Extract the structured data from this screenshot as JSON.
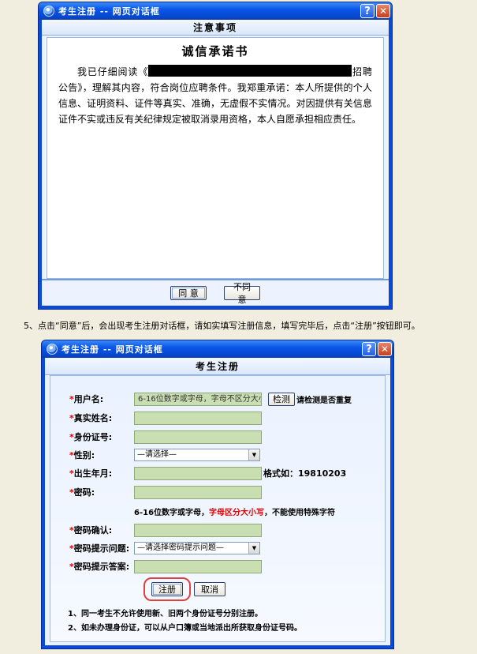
{
  "dialog1": {
    "title": "考生注册 -- 网页对话框",
    "help": "?",
    "close": "✕",
    "header": "注意事项",
    "pledge_title": "诚信承诺书",
    "text_before": "我已仔细阅读《",
    "text_after": "招聘公告》，理解其内容，符合岗位应聘条件。我郑重承诺：本人所提供的个人信息、证明资料、证件等真实、准确，无虚假不实情况。对因提供有关信息证件不实或违反有关纪律规定被取消录用资格，本人自愿承担相应责任。",
    "agree_label": "同 意",
    "disagree_label": "不同意"
  },
  "instruction": "5、点击“同意”后，会出现考生注册对话框，请如实填写注册信息，填写完毕后，点击“注册”按钮即可。",
  "dialog2": {
    "title": "考生注册 -- 网页对话框",
    "help": "?",
    "close": "✕",
    "header": "考生注册",
    "star": "*",
    "fields": {
      "username": {
        "label": "用户名:",
        "placeholder": "6-16位数字或字母，字母不区分大小写"
      },
      "realname": {
        "label": "真实姓名:"
      },
      "idnumber": {
        "label": "身份证号:"
      },
      "gender": {
        "label": "性别:",
        "selected": "—请选择—"
      },
      "birth": {
        "label": "出生年月:",
        "hint": "格式如：19810203"
      },
      "password": {
        "label": "密码:"
      },
      "password_confirm": {
        "label": "密码确认:"
      },
      "question": {
        "label": "密码提示问题:",
        "selected": "—请选择密码提示问题—"
      },
      "answer": {
        "label": "密码提示答案:"
      }
    },
    "check_button": "检测",
    "check_hint": "请检测是否重复",
    "pwd_note_a": "6-16位数字或字母，",
    "pwd_note_red": "字母区分大小写",
    "pwd_note_b": "，不能使用特殊字符",
    "register_button": "注册",
    "cancel_button": "取消",
    "note1": "1、同一考生不允许使用新、旧两个身份证号分别注册。",
    "note2": "2、如未办理身份证，可以从户口簿或当地派出所获取身份证号码。"
  },
  "colors": {
    "titlebar": "#0a56e8",
    "field_bg": "#c9dfb2",
    "required_star": "#d40000",
    "highlight_circle": "#e04040"
  }
}
